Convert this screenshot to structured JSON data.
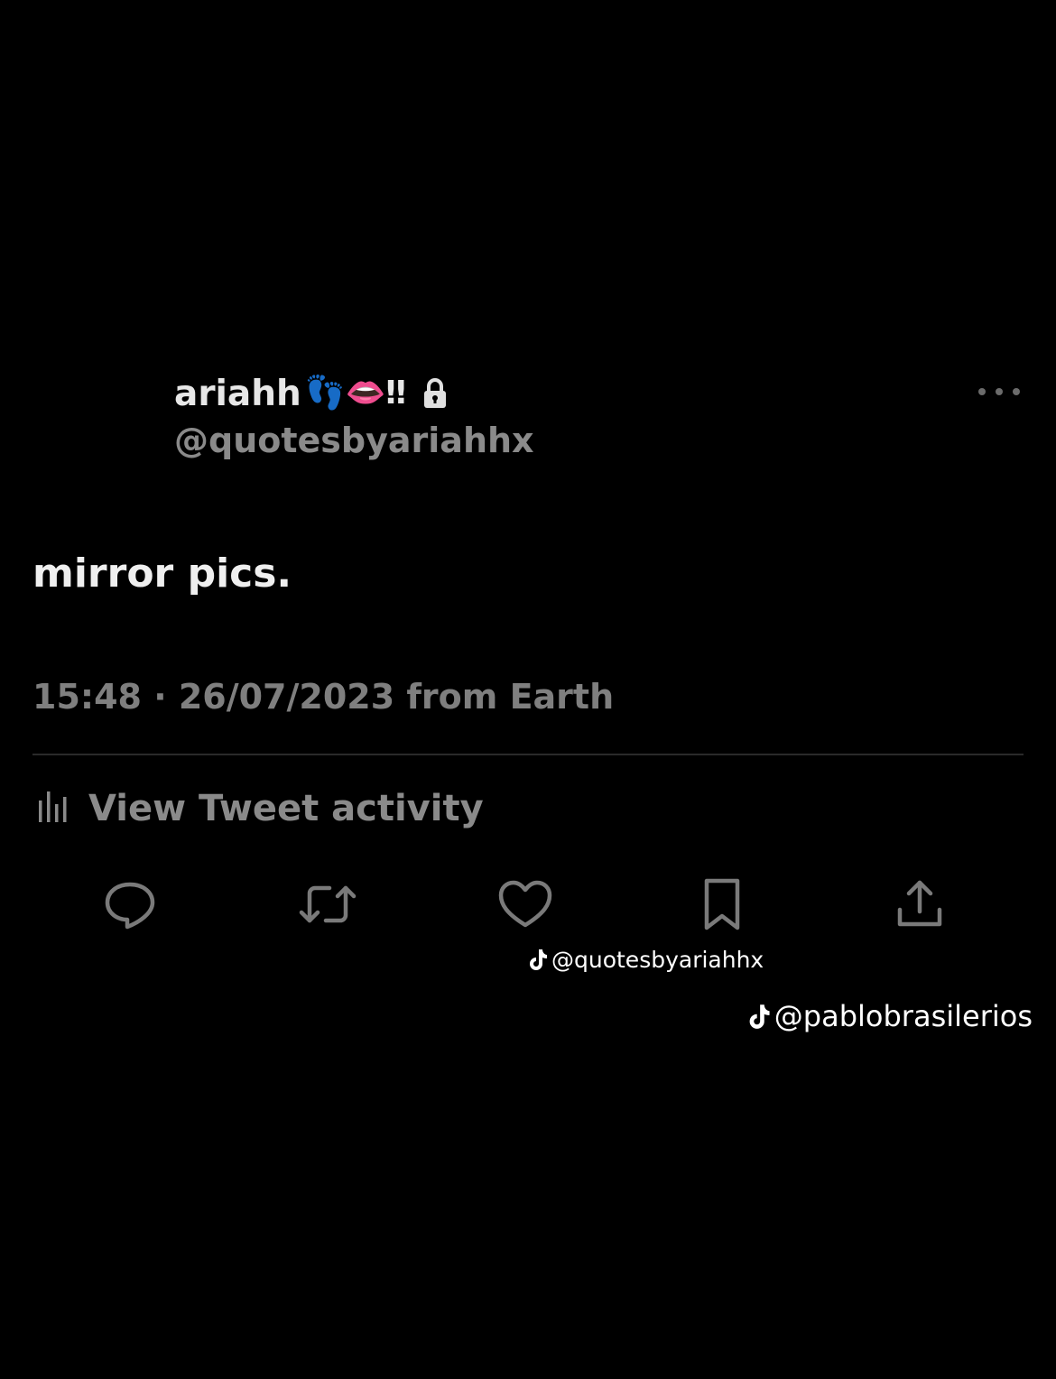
{
  "tweet": {
    "display_name": "ariahh",
    "name_emojis": "👣👄‼",
    "locked_icon": "lock-icon",
    "handle": "@quotesbyariahhx",
    "text": "mirror pics.",
    "timestamp": "15:48 · 26/07/2023 from Earth",
    "activity_label": "View Tweet activity"
  },
  "actions": [
    {
      "name": "reply",
      "icon": "speech-bubble-icon"
    },
    {
      "name": "retweet",
      "icon": "retweet-icon"
    },
    {
      "name": "like",
      "icon": "heart-icon"
    },
    {
      "name": "bookmark",
      "icon": "bookmark-icon"
    },
    {
      "name": "share",
      "icon": "share-upload-icon"
    }
  ],
  "watermarks": {
    "overlay_handle": "@quotesbyariahhx",
    "tiktok_handle": "@pablobrasilerios",
    "icon": "tiktok-note-icon"
  },
  "colors": {
    "background": "#000000",
    "primary_text": "#e7e7e7",
    "secondary_text": "#8a8a8a",
    "divider": "#2a2a2a",
    "icon": "#7a7a7a",
    "lock": "#e0e0e0"
  }
}
